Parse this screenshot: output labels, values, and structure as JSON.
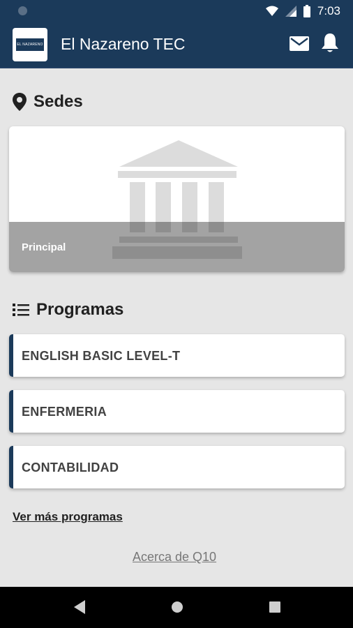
{
  "status_bar": {
    "time": "7:03"
  },
  "app_bar": {
    "title": "El Nazareno TEC",
    "logo_text": "EL NAZARENO"
  },
  "sedes": {
    "title": "Sedes",
    "cards": [
      {
        "label": "Principal"
      }
    ]
  },
  "programas": {
    "title": "Programas",
    "items": [
      {
        "label": "ENGLISH BASIC LEVEL-T"
      },
      {
        "label": "ENFERMERIA"
      },
      {
        "label": "CONTABILIDAD"
      }
    ]
  },
  "links": {
    "more": "Ver más programas",
    "about": "Acerca de Q10"
  },
  "colors": {
    "primary": "#1b3a5a",
    "background": "#e6e6e6",
    "overlay": "#a3a3a3"
  }
}
